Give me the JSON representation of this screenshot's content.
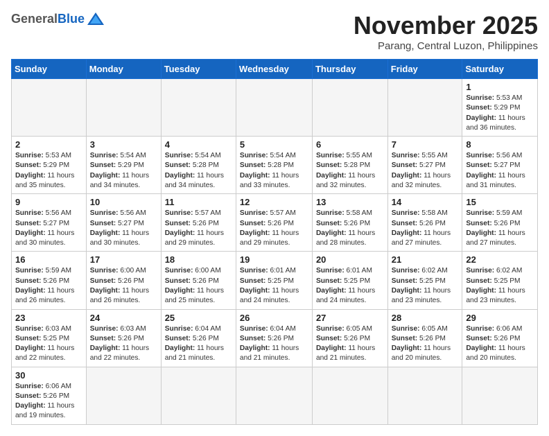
{
  "header": {
    "logo_general": "General",
    "logo_blue": "Blue",
    "month_title": "November 2025",
    "subtitle": "Parang, Central Luzon, Philippines"
  },
  "weekdays": [
    "Sunday",
    "Monday",
    "Tuesday",
    "Wednesday",
    "Thursday",
    "Friday",
    "Saturday"
  ],
  "weeks": [
    [
      {
        "day": "",
        "empty": true
      },
      {
        "day": "",
        "empty": true
      },
      {
        "day": "",
        "empty": true
      },
      {
        "day": "",
        "empty": true
      },
      {
        "day": "",
        "empty": true
      },
      {
        "day": "",
        "empty": true
      },
      {
        "day": "1",
        "sunrise": "5:53 AM",
        "sunset": "5:29 PM",
        "daylight": "11 hours and 36 minutes."
      }
    ],
    [
      {
        "day": "2",
        "sunrise": "5:53 AM",
        "sunset": "5:29 PM",
        "daylight": "11 hours and 35 minutes."
      },
      {
        "day": "3",
        "sunrise": "5:54 AM",
        "sunset": "5:29 PM",
        "daylight": "11 hours and 34 minutes."
      },
      {
        "day": "4",
        "sunrise": "5:54 AM",
        "sunset": "5:28 PM",
        "daylight": "11 hours and 34 minutes."
      },
      {
        "day": "5",
        "sunrise": "5:54 AM",
        "sunset": "5:28 PM",
        "daylight": "11 hours and 33 minutes."
      },
      {
        "day": "6",
        "sunrise": "5:55 AM",
        "sunset": "5:28 PM",
        "daylight": "11 hours and 32 minutes."
      },
      {
        "day": "7",
        "sunrise": "5:55 AM",
        "sunset": "5:27 PM",
        "daylight": "11 hours and 32 minutes."
      },
      {
        "day": "8",
        "sunrise": "5:56 AM",
        "sunset": "5:27 PM",
        "daylight": "11 hours and 31 minutes."
      }
    ],
    [
      {
        "day": "9",
        "sunrise": "5:56 AM",
        "sunset": "5:27 PM",
        "daylight": "11 hours and 30 minutes."
      },
      {
        "day": "10",
        "sunrise": "5:56 AM",
        "sunset": "5:27 PM",
        "daylight": "11 hours and 30 minutes."
      },
      {
        "day": "11",
        "sunrise": "5:57 AM",
        "sunset": "5:26 PM",
        "daylight": "11 hours and 29 minutes."
      },
      {
        "day": "12",
        "sunrise": "5:57 AM",
        "sunset": "5:26 PM",
        "daylight": "11 hours and 29 minutes."
      },
      {
        "day": "13",
        "sunrise": "5:58 AM",
        "sunset": "5:26 PM",
        "daylight": "11 hours and 28 minutes."
      },
      {
        "day": "14",
        "sunrise": "5:58 AM",
        "sunset": "5:26 PM",
        "daylight": "11 hours and 27 minutes."
      },
      {
        "day": "15",
        "sunrise": "5:59 AM",
        "sunset": "5:26 PM",
        "daylight": "11 hours and 27 minutes."
      }
    ],
    [
      {
        "day": "16",
        "sunrise": "5:59 AM",
        "sunset": "5:26 PM",
        "daylight": "11 hours and 26 minutes."
      },
      {
        "day": "17",
        "sunrise": "6:00 AM",
        "sunset": "5:26 PM",
        "daylight": "11 hours and 26 minutes."
      },
      {
        "day": "18",
        "sunrise": "6:00 AM",
        "sunset": "5:26 PM",
        "daylight": "11 hours and 25 minutes."
      },
      {
        "day": "19",
        "sunrise": "6:01 AM",
        "sunset": "5:25 PM",
        "daylight": "11 hours and 24 minutes."
      },
      {
        "day": "20",
        "sunrise": "6:01 AM",
        "sunset": "5:25 PM",
        "daylight": "11 hours and 24 minutes."
      },
      {
        "day": "21",
        "sunrise": "6:02 AM",
        "sunset": "5:25 PM",
        "daylight": "11 hours and 23 minutes."
      },
      {
        "day": "22",
        "sunrise": "6:02 AM",
        "sunset": "5:25 PM",
        "daylight": "11 hours and 23 minutes."
      }
    ],
    [
      {
        "day": "23",
        "sunrise": "6:03 AM",
        "sunset": "5:25 PM",
        "daylight": "11 hours and 22 minutes."
      },
      {
        "day": "24",
        "sunrise": "6:03 AM",
        "sunset": "5:26 PM",
        "daylight": "11 hours and 22 minutes."
      },
      {
        "day": "25",
        "sunrise": "6:04 AM",
        "sunset": "5:26 PM",
        "daylight": "11 hours and 21 minutes."
      },
      {
        "day": "26",
        "sunrise": "6:04 AM",
        "sunset": "5:26 PM",
        "daylight": "11 hours and 21 minutes."
      },
      {
        "day": "27",
        "sunrise": "6:05 AM",
        "sunset": "5:26 PM",
        "daylight": "11 hours and 21 minutes."
      },
      {
        "day": "28",
        "sunrise": "6:05 AM",
        "sunset": "5:26 PM",
        "daylight": "11 hours and 20 minutes."
      },
      {
        "day": "29",
        "sunrise": "6:06 AM",
        "sunset": "5:26 PM",
        "daylight": "11 hours and 20 minutes."
      }
    ],
    [
      {
        "day": "30",
        "sunrise": "6:06 AM",
        "sunset": "5:26 PM",
        "daylight": "11 hours and 19 minutes."
      },
      {
        "day": "",
        "empty": true
      },
      {
        "day": "",
        "empty": true
      },
      {
        "day": "",
        "empty": true
      },
      {
        "day": "",
        "empty": true
      },
      {
        "day": "",
        "empty": true
      },
      {
        "day": "",
        "empty": true
      }
    ]
  ],
  "labels": {
    "sunrise": "Sunrise:",
    "sunset": "Sunset:",
    "daylight": "Daylight:"
  }
}
